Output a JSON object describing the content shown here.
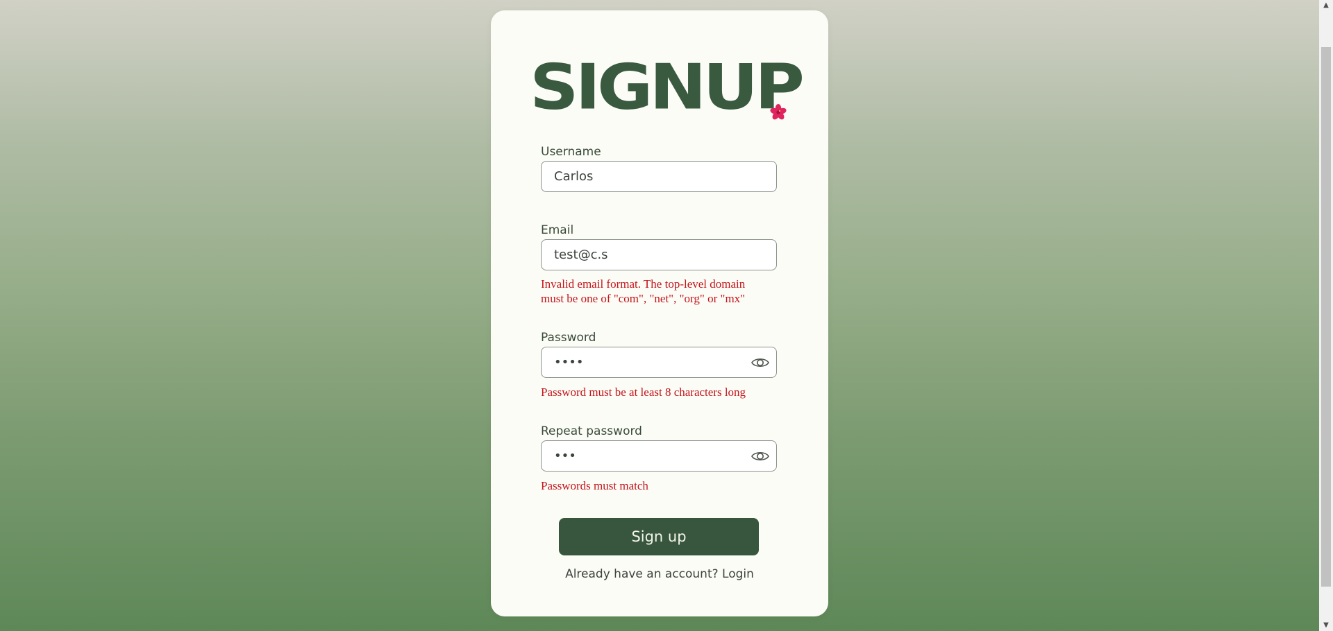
{
  "form": {
    "title": "SIGNUP",
    "flower_icon": "hibiscus-flower-icon",
    "username": {
      "label": "Username",
      "value": "Carlos"
    },
    "email": {
      "label": "Email",
      "value": "test@c.s",
      "error_line1": "Invalid email format. The top-level domain",
      "error_line2": "must be one of \"com\", \"net\", \"org\" or \"mx\""
    },
    "password": {
      "label": "Password",
      "value": "••••",
      "error": "Password must be at least 8 characters long",
      "toggle_icon": "eye-icon"
    },
    "repeat_password": {
      "label": "Repeat password",
      "value": "•••",
      "error": "Passwords must match",
      "toggle_icon": "eye-icon"
    },
    "submit_label": "Sign up",
    "footer_text": "Already have an account? ",
    "footer_link": "Login"
  },
  "colors": {
    "brand": "#3a5a40",
    "button": "#37563d",
    "error": "#c3141b",
    "card": "#fcfcf6"
  }
}
